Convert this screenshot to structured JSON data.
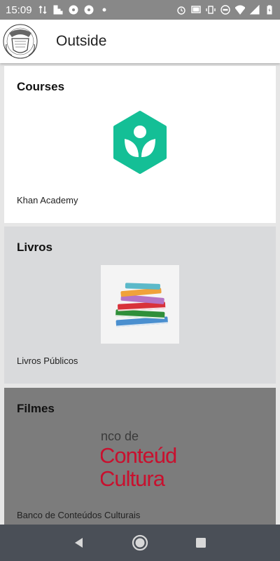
{
  "status_bar": {
    "time": "15:09",
    "left_icons": [
      "data-transfer-icon",
      "signal-bars-icon",
      "aperture-icon",
      "aperture-icon",
      "dot-icon"
    ],
    "right_icons": [
      "alarm-icon",
      "cast-icon",
      "vibrate-icon",
      "do-not-disturb-icon",
      "wifi-icon",
      "cell-signal-icon",
      "battery-charging-icon"
    ]
  },
  "app_bar": {
    "title": "Outside",
    "logo_icon": "seal-logo-icon"
  },
  "cards": [
    {
      "title": "Courses",
      "caption": "Khan Academy",
      "image_icon": "khan-academy-logo-icon"
    },
    {
      "title": "Livros",
      "caption": "Livros Públicos",
      "image_icon": "books-stack-icon"
    },
    {
      "title": "Filmes",
      "caption": "Banco de Conteúdos Culturais",
      "image_icon": "banco-conteudos-culturais-logo"
    }
  ],
  "filmes_logo_text": {
    "line1": "nco de",
    "line2": "Conteúd",
    "line3": "Cultura"
  },
  "nav_bar": {
    "buttons": [
      "back-icon",
      "home-icon",
      "recents-icon"
    ]
  },
  "colors": {
    "status_bar": "#888888",
    "khan_green": "#14bf96",
    "livros_card": "#d9dadc",
    "filmes_card": "#7c7c7c",
    "nav_bar": "#4a4f57",
    "banco_red": "#c8102e"
  }
}
